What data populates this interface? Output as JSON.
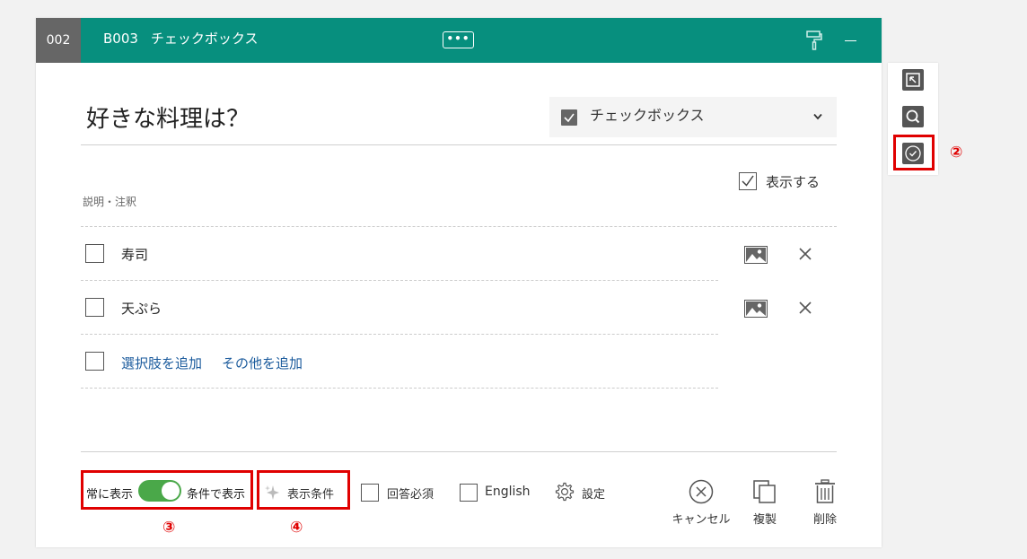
{
  "header": {
    "question_number": "002",
    "code": "B003",
    "type_name": "チェックボックス",
    "more_label": "•••"
  },
  "question": {
    "title": "好きな料理は？",
    "type_select_value": "チェックボックス",
    "show_label": "表示する",
    "description_label": "説明・注釈"
  },
  "options": [
    {
      "label": "寿司"
    },
    {
      "label": "天ぷら"
    }
  ],
  "add": {
    "add_choice": "選択肢を追加",
    "add_other": "その他を追加"
  },
  "footer": {
    "always_show": "常に表示",
    "conditional_show": "条件で表示",
    "display_conditions": "表示条件",
    "required": "回答必須",
    "english": "English",
    "settings": "設定",
    "cancel": "キャンセル",
    "duplicate": "複製",
    "delete": "削除"
  },
  "markers": {
    "m2": "②",
    "m3": "③",
    "m4": "④"
  },
  "colors": {
    "header": "#078f7e",
    "number_bg": "#666666",
    "toggle_on": "#4aa849",
    "link": "#1a5a9c",
    "highlight": "#e00000"
  },
  "icons": [
    "paint-roller-icon",
    "chevron-down-icon",
    "image-icon",
    "close-icon",
    "sparkle-icon",
    "gear-icon",
    "cancel-circle-icon",
    "copy-icon",
    "trash-icon",
    "branch-icon",
    "search-icon",
    "check-circle-icon"
  ]
}
